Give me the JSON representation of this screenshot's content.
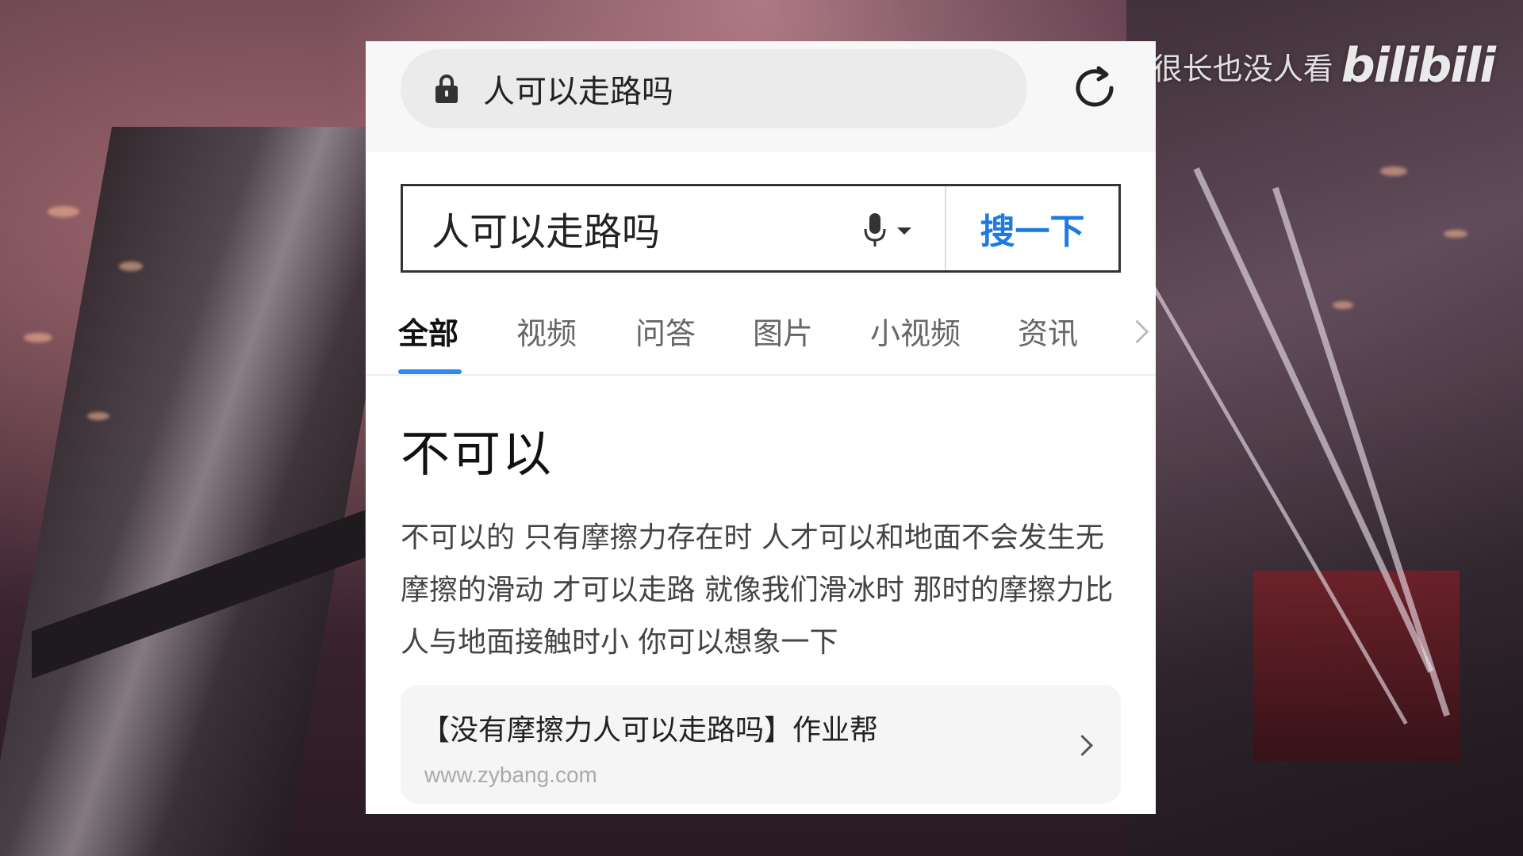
{
  "watermark": {
    "text": "字很长也没人看",
    "logo": "bilibili"
  },
  "browser": {
    "url_text": "人可以走路吗",
    "icons": {
      "lock": "lock-icon",
      "reload": "reload-icon"
    }
  },
  "search": {
    "query": "人可以走路吗",
    "button_label": "搜一下",
    "icons": {
      "mic": "mic-icon",
      "dropdown": "caret-down-icon"
    }
  },
  "tabs": [
    {
      "label": "全部",
      "active": true
    },
    {
      "label": "视频",
      "active": false
    },
    {
      "label": "问答",
      "active": false
    },
    {
      "label": "图片",
      "active": false
    },
    {
      "label": "小视频",
      "active": false
    },
    {
      "label": "资讯",
      "active": false
    }
  ],
  "answer": {
    "title": "不可以",
    "body": "不可以的 只有摩擦力存在时 人才可以和地面不会发生无摩擦的滑动 才可以走路 就像我们滑冰时 那时的摩擦力比人与地面接触时小 你可以想象一下"
  },
  "source": {
    "title": "【没有摩擦力人可以走路吗】作业帮",
    "url": "www.zybang.com"
  },
  "colors": {
    "accent": "#1e7ae0",
    "tab_underline": "#2e8bf0",
    "panel_bg": "#ffffff",
    "url_bar_bg": "#ebebeb"
  }
}
